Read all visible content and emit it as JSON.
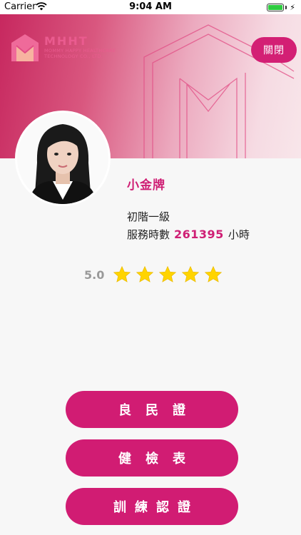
{
  "status_bar": {
    "carrier": "Carrier",
    "time": "9:04 AM"
  },
  "header": {
    "logo_title": "MHHT",
    "logo_subtitle_line1": "MOMMY HAPPY HEALTHCARE",
    "logo_subtitle_line2": "TECHNOLOGY CO., LTD.",
    "close_label": "關閉",
    "brand_color": "#d31f74"
  },
  "profile": {
    "name": "小金牌",
    "level": "初階一級",
    "hours_label": "服務時數",
    "hours_value": "261395",
    "hours_unit": "小時",
    "rating_value": "5.0",
    "stars_filled": 5,
    "stars_total": 5
  },
  "actions": {
    "good_citizen_cert": "良民證",
    "health_check_form": "健檢表",
    "training_cert": "訓練認證"
  }
}
